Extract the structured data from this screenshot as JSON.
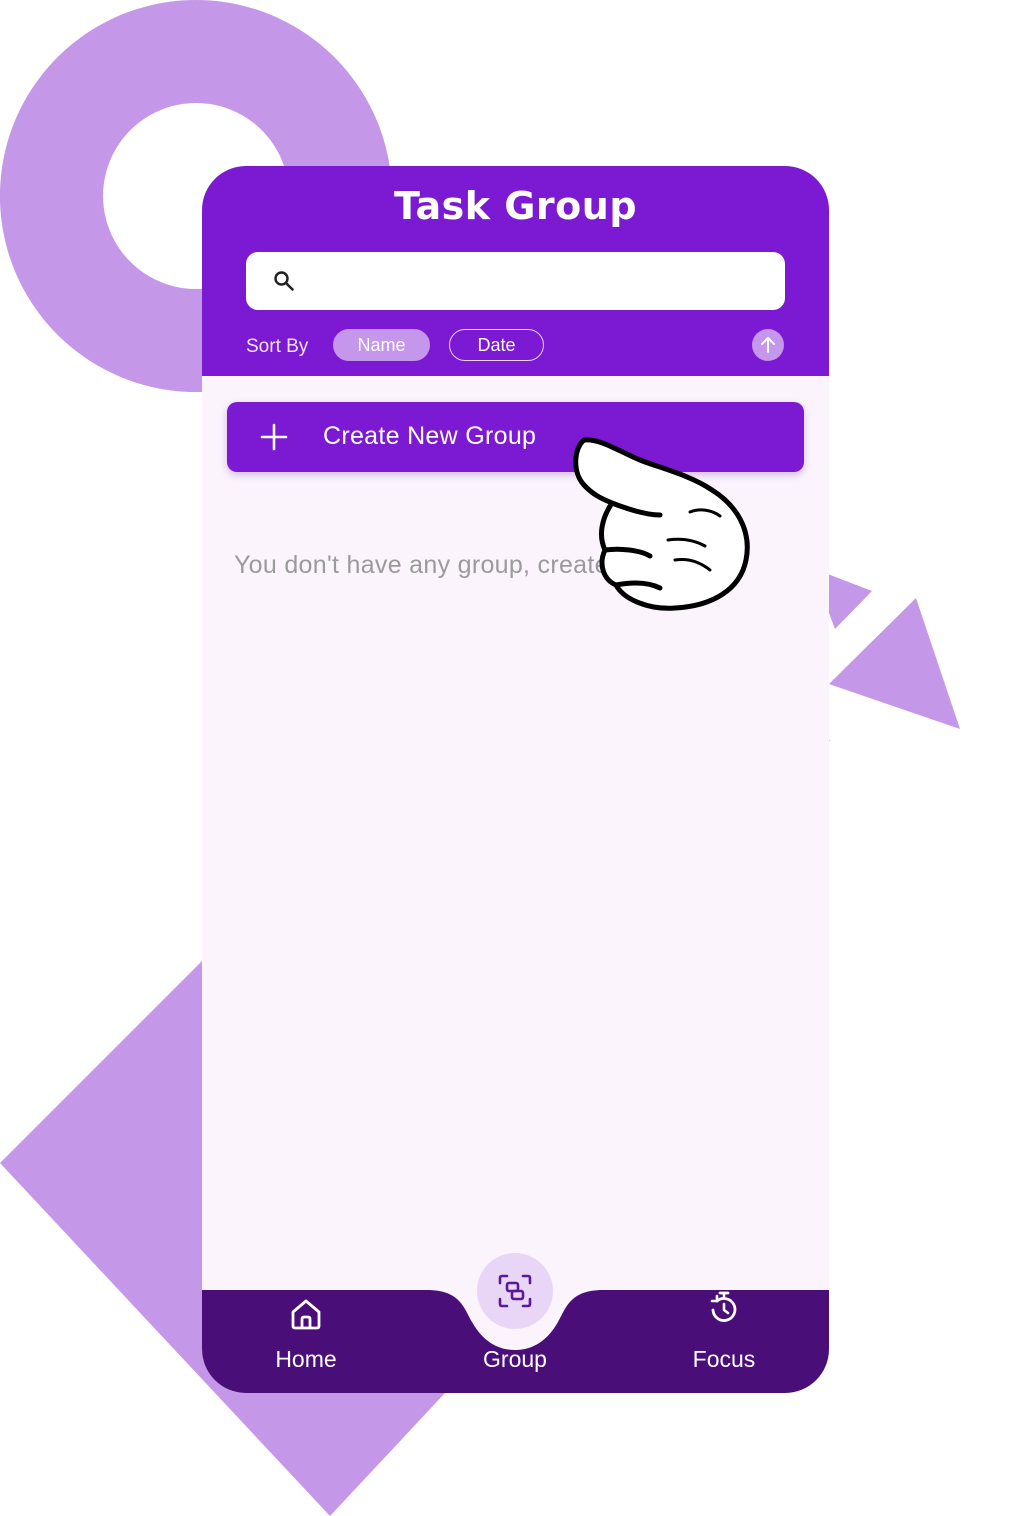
{
  "header": {
    "title": "Task Group"
  },
  "search": {
    "placeholder": "",
    "value": ""
  },
  "sort": {
    "label": "Sort By",
    "options": [
      {
        "label": "Name",
        "selected": true
      },
      {
        "label": "Date",
        "selected": false
      }
    ],
    "direction_icon": "arrow-up-icon"
  },
  "actions": {
    "create_label": "Create New Group",
    "create_icon": "plus-icon"
  },
  "empty_state": {
    "message": "You don't have any group, create one now!"
  },
  "bottom_nav": {
    "items": [
      {
        "label": "Home",
        "icon": "home-icon"
      },
      {
        "label": "Group",
        "icon": "group-icon",
        "active": true
      },
      {
        "label": "Focus",
        "icon": "timer-icon"
      }
    ]
  },
  "colors": {
    "primary": "#7c19d2",
    "nav_background": "#4a0e78",
    "accent_light": "#c496ec",
    "decoration": "#c497e9",
    "surface": "#fcf4fd"
  }
}
